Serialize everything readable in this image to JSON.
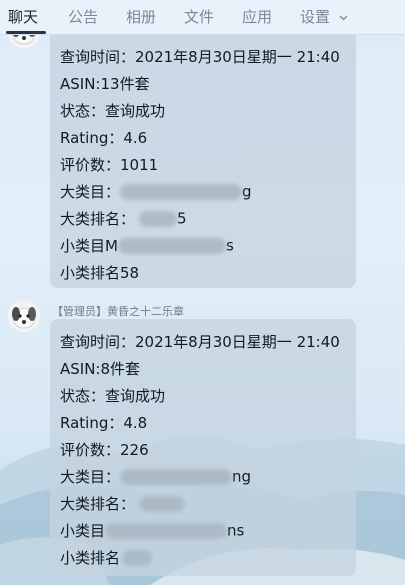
{
  "tabs": [
    {
      "label": "聊天"
    },
    {
      "label": "公告"
    },
    {
      "label": "相册"
    },
    {
      "label": "文件"
    },
    {
      "label": "应用"
    },
    {
      "label": "设置"
    }
  ],
  "messages": [
    {
      "query_time": "查询时间：2021年8月30日星期一 21:40",
      "asin": "ASIN:13件套",
      "status": "状态：查询成功",
      "rating": "Rating：4.6",
      "reviews": "评价数：1011",
      "main_cat_prefix": "大类目：",
      "main_cat_visible": "g",
      "main_rank_prefix": "大类排名：",
      "main_rank_visible": "5",
      "sub_cat_prefix": "小类目M",
      "sub_cat_visible": "s",
      "sub_rank": "小类排名58"
    },
    {
      "sender": "【管理员】黄昏之十二乐章",
      "query_time": "查询时间：2021年8月30日星期一 21:40",
      "asin": "ASIN:8件套",
      "status": "状态：查询成功",
      "rating": "Rating：4.8",
      "reviews": "评价数：226",
      "main_cat_prefix": "大类目：",
      "main_cat_visible": "ng",
      "main_rank_prefix": "大类排名：",
      "sub_cat_prefix": "小类目",
      "sub_cat_visible": "ns",
      "sub_rank_prefix": "小类排名"
    }
  ]
}
